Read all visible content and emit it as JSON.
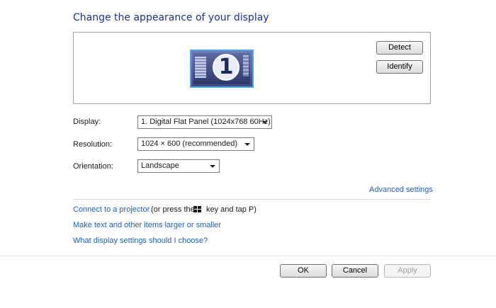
{
  "page": {
    "title": "Change the appearance of your display"
  },
  "preview": {
    "monitor_number": "1",
    "detect_label": "Detect",
    "identify_label": "Identify"
  },
  "settings": {
    "display_label": "Display:",
    "display_value": "1. Digital Flat Panel (1024x768 60Hz)",
    "resolution_label": "Resolution:",
    "resolution_value": "1024 × 600 (recommended)",
    "orientation_label": "Orientation:",
    "orientation_value": "Landscape"
  },
  "links": {
    "advanced_settings": "Advanced settings",
    "connect_projector": "Connect to a projector",
    "projector_hint_prefix": "(or press the",
    "projector_hint_suffix": "key and tap P)",
    "text_larger": "Make text and other items larger or smaller",
    "which_settings": "What display settings should I choose?"
  },
  "footer": {
    "ok_label": "OK",
    "cancel_label": "Cancel",
    "apply_label": "Apply"
  },
  "icons": [
    "windows-key-icon",
    "monitor-icon",
    "dropdown-arrow-icon"
  ]
}
